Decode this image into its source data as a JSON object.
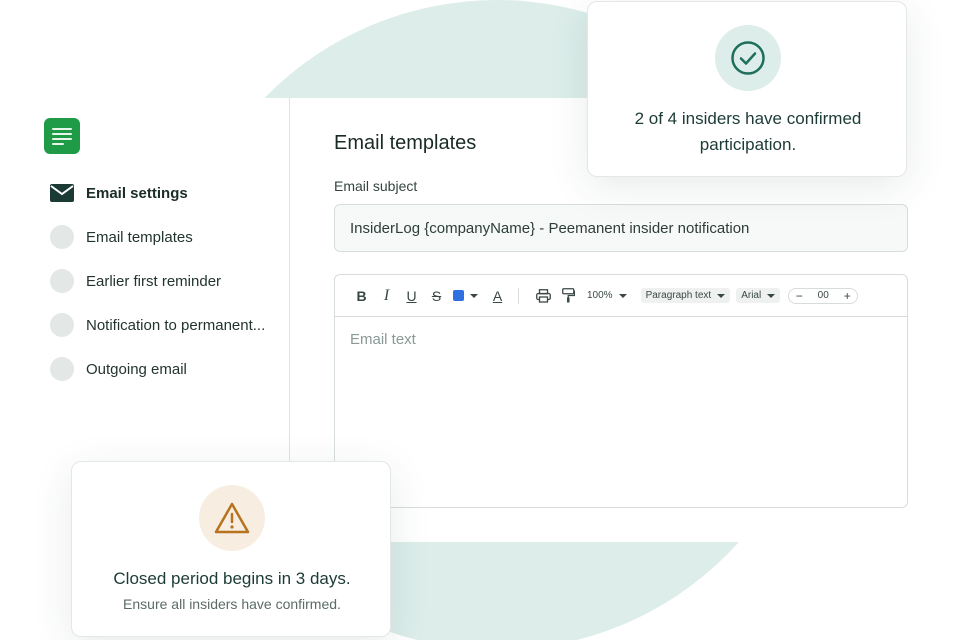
{
  "sidebar": {
    "items": [
      {
        "label": "Email settings",
        "icon": "envelope-icon",
        "active": true
      },
      {
        "label": "Email templates"
      },
      {
        "label": "Earlier first reminder"
      },
      {
        "label": "Notification to permanent..."
      },
      {
        "label": "Outgoing email"
      }
    ]
  },
  "main": {
    "title": "Email templates",
    "subject_label": "Email subject",
    "subject_value": "InsiderLog {companyName} - Peemanent insider notification",
    "editor": {
      "placeholder": "Email text",
      "toolbar": {
        "bold": "B",
        "italic": "I",
        "underline": "U",
        "strike": "S",
        "text_color": "#2f6fe0",
        "font_color_glyph": "A",
        "zoom": "100%",
        "style": "Paragraph text",
        "font": "Arial",
        "size_minus": "−",
        "size_value": "00",
        "size_plus": "+"
      }
    }
  },
  "confirm_card": {
    "text": "2 of 4 insiders have confirmed participation."
  },
  "warning_card": {
    "title": "Closed period begins in 3 days.",
    "subtitle": "Ensure all insiders have confirmed."
  },
  "colors": {
    "accent_green": "#1f9a46",
    "teal_soft": "#dcedea",
    "warning": "#b8731f"
  }
}
